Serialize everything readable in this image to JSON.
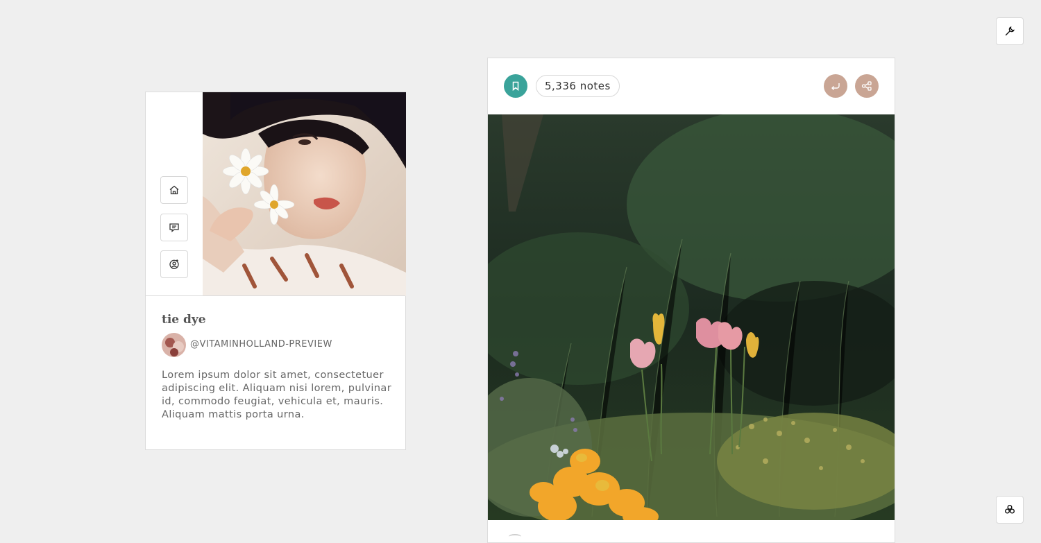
{
  "sidebar_card": {
    "blog_title": "tie dye",
    "handle": "@VITAMINHOLLAND-PREVIEW",
    "description": "Lorem ipsum dolor sit amet, consectetuer adipiscing elit. Aliquam nisi lorem, pulvinar id, commodo feugiat, vehicula et, mauris. Aliquam mattis porta urna.",
    "nav": [
      {
        "icon": "home-icon"
      },
      {
        "icon": "message-icon"
      },
      {
        "icon": "user-follow-icon"
      }
    ]
  },
  "post": {
    "notes_label": "5,336 notes",
    "actions": [
      {
        "icon": "bookmark-icon",
        "color": "#3aa39a"
      },
      {
        "icon": "reblog-icon",
        "color": "#c9a594"
      },
      {
        "icon": "share-icon",
        "color": "#c9a594"
      }
    ]
  },
  "tools": [
    {
      "icon": "wrench-icon"
    },
    {
      "icon": "theme-icon"
    }
  ]
}
